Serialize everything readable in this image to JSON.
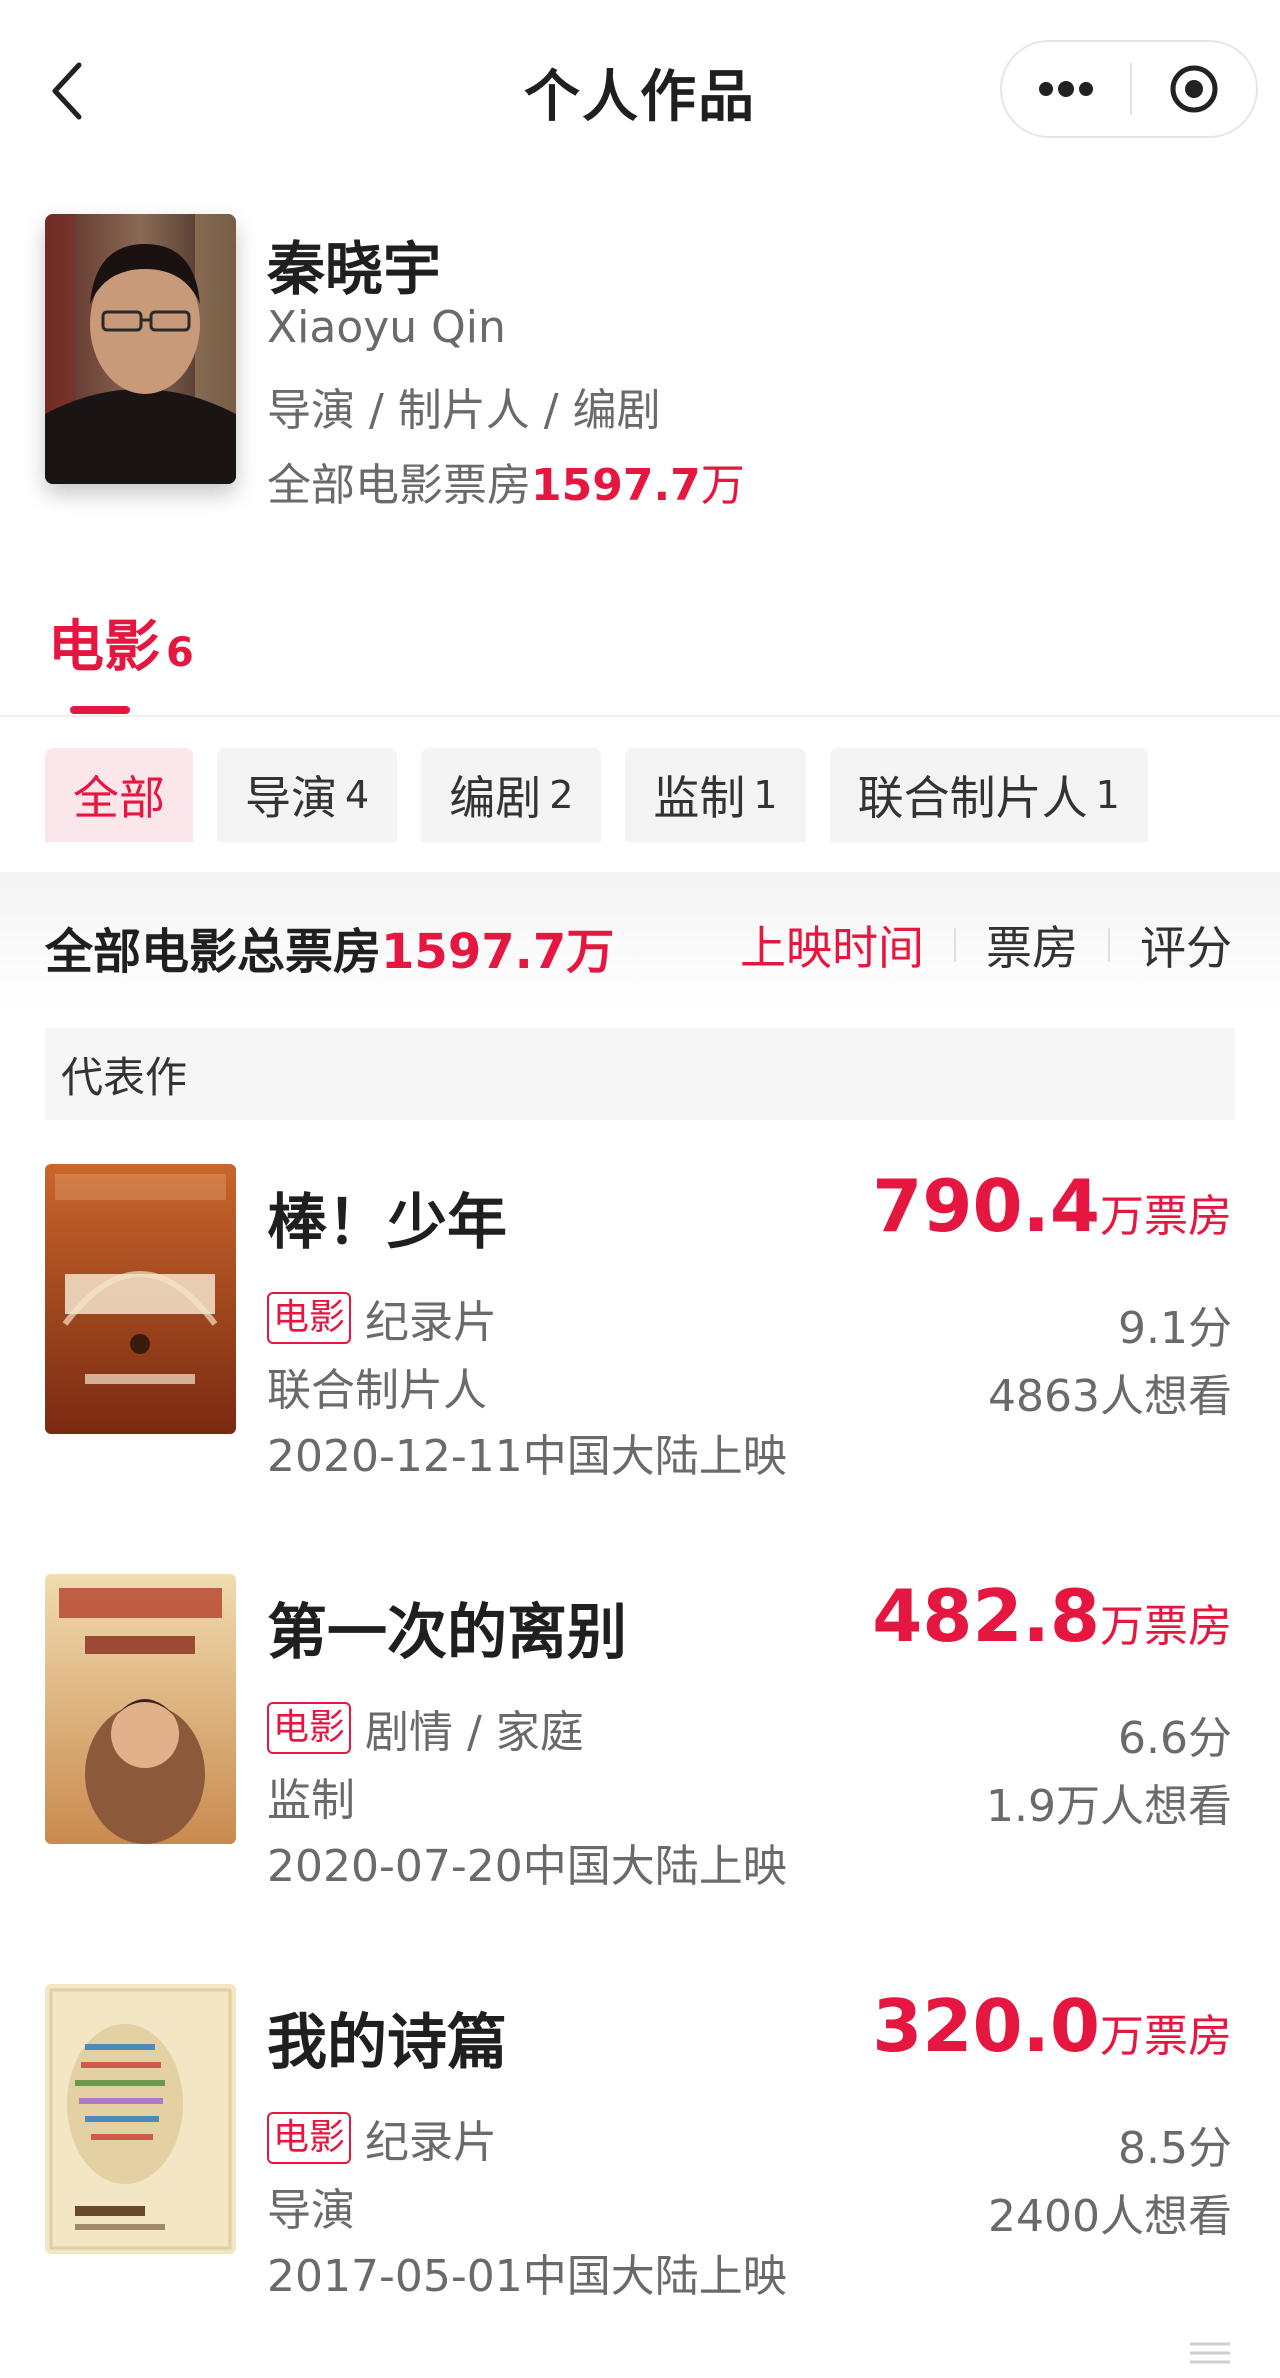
{
  "nav": {
    "title": "个人作品"
  },
  "profile": {
    "name": "秦晓宇",
    "en_name": "Xiaoyu Qin",
    "roles": "导演 / 制片人 / 编剧",
    "total_label": "全部电影票房",
    "total_value": "1597.7",
    "total_unit": "万"
  },
  "category": {
    "label": "电影",
    "count": "6"
  },
  "chips": [
    {
      "label": "全部",
      "count": ""
    },
    {
      "label": "导演",
      "count": "4"
    },
    {
      "label": "编剧",
      "count": "2"
    },
    {
      "label": "监制",
      "count": "1"
    },
    {
      "label": "联合制片人",
      "count": "1"
    }
  ],
  "summary": {
    "label": "全部电影总票房",
    "value": "1597.7万",
    "sorts": [
      "上映时间",
      "票房",
      "评分"
    ]
  },
  "section_label": "代表作",
  "movies": [
    {
      "title": "棒！少年",
      "tag": "电影",
      "genre": "纪录片",
      "role": "联合制片人",
      "date": "2020-12-11中国大陆上映",
      "box_value": "790.4",
      "box_unit": "万票房",
      "score": "9.1分",
      "want": "4863人想看"
    },
    {
      "title": "第一次的离别",
      "tag": "电影",
      "genre": "剧情 / 家庭",
      "role": "监制",
      "date": "2020-07-20中国大陆上映",
      "box_value": "482.8",
      "box_unit": "万票房",
      "score": "6.6分",
      "want": "1.9万人想看"
    },
    {
      "title": "我的诗篇",
      "tag": "电影",
      "genre": "纪录片",
      "role": "导演",
      "date": "2017-05-01中国大陆上映",
      "box_value": "320.0",
      "box_unit": "万票房",
      "score": "8.5分",
      "want": "2400人想看"
    }
  ],
  "colors": {
    "accent": "#e5163f",
    "secondary_text": "#6a6a6a"
  }
}
